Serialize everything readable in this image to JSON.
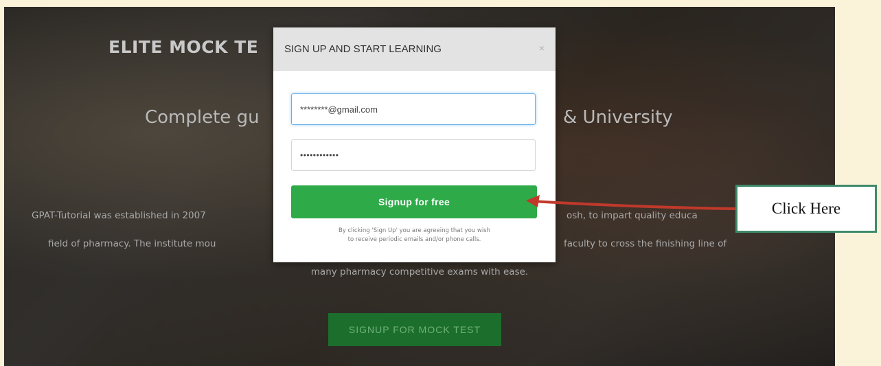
{
  "background_page": {
    "logo_text": "ELITE MOCK TE",
    "subtitle_left": "Complete gu",
    "subtitle_right": "& University",
    "para_line1_left": "GPAT-Tutorial was established in 2007",
    "para_line1_right": "osh, to impart quality educa",
    "para_line2_left": "field of pharmacy. The institute mou",
    "para_line2_right": "faculty to cross the finishing line of",
    "para_line3": "many pharmacy competitive exams with ease.",
    "cta_label": "SIGNUP FOR MOCK TEST"
  },
  "modal": {
    "title": "SIGN UP AND START LEARNING",
    "close_glyph": "×",
    "email_value": "********@gmail.com",
    "password_value": "••••••••••••",
    "signup_label": "Signup for free",
    "disclaimer_line1": "By clicking 'Sign Up' you are agreeing that you wish",
    "disclaimer_line2": "to receive periodic emails and/or phone calls."
  },
  "callout": {
    "label": "Click Here",
    "border_color": "#3d8a6a",
    "arrow_color": "#c0392b"
  },
  "colors": {
    "signup_green": "#2eaa49",
    "focus_blue": "#66afe9",
    "page_bg": "#fbf3d9"
  }
}
